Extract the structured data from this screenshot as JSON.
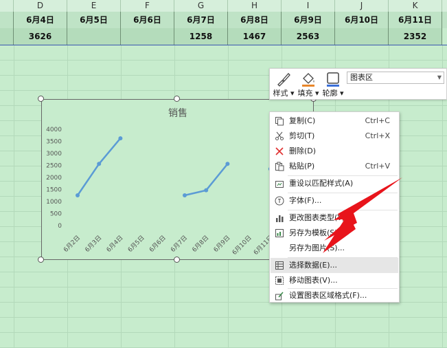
{
  "columns": [
    {
      "letter": "D",
      "header": "6月4日",
      "value": "3626"
    },
    {
      "letter": "E",
      "header": "6月5日",
      "value": ""
    },
    {
      "letter": "F",
      "header": "6月6日",
      "value": ""
    },
    {
      "letter": "G",
      "header": "6月7日",
      "value": "1258"
    },
    {
      "letter": "H",
      "header": "6月8日",
      "value": "1467"
    },
    {
      "letter": "I",
      "header": "6月9日",
      "value": "2563"
    },
    {
      "letter": "J",
      "header": "6月10日",
      "value": ""
    },
    {
      "letter": "K",
      "header": "6月11日",
      "value": "2352"
    }
  ],
  "toolbar": {
    "style_label": "样式",
    "fill_label": "填充",
    "outline_label": "轮廓",
    "element_select_value": "图表区"
  },
  "context_menu": {
    "items": [
      {
        "label": "复制(C)",
        "shortcut": "Ctrl+C",
        "icon": "copy-icon"
      },
      {
        "label": "剪切(T)",
        "shortcut": "Ctrl+X",
        "icon": "scissors-icon"
      },
      {
        "label": "删除(D)",
        "shortcut": "",
        "icon": "delete-x-icon"
      },
      {
        "label": "粘贴(P)",
        "shortcut": "Ctrl+V",
        "icon": "paste-icon"
      },
      {
        "label": "重设以匹配样式(A)",
        "shortcut": "",
        "icon": "reset-style-icon"
      },
      {
        "label": "字体(F)...",
        "shortcut": "",
        "icon": "font-icon"
      },
      {
        "label": "更改图表类型(Y)...",
        "shortcut": "",
        "icon": "chart-type-icon"
      },
      {
        "label": "另存为模板(S)...",
        "shortcut": "",
        "icon": "save-template-icon"
      },
      {
        "label": "另存为图片(S)...",
        "shortcut": "",
        "icon": ""
      },
      {
        "label": "选择数据(E)...",
        "shortcut": "",
        "icon": "select-data-icon"
      },
      {
        "label": "移动图表(V)...",
        "shortcut": "",
        "icon": "move-chart-icon"
      },
      {
        "label": "设置图表区域格式(F)...",
        "shortcut": "",
        "icon": "format-area-icon"
      }
    ],
    "hovered_index": 9
  },
  "chart_data": {
    "type": "line",
    "title": "销售",
    "categories": [
      "6月2日",
      "6月3日",
      "6月4日",
      "6月5日",
      "6月6日",
      "6月7日",
      "6月8日",
      "6月9日",
      "6月10日",
      "6月11日"
    ],
    "series": [
      {
        "values": [
          1258,
          2563,
          3626,
          null,
          null,
          1258,
          1467,
          2563,
          null,
          2352
        ],
        "color": "#5b9bd5"
      }
    ],
    "ylim": [
      0,
      4000
    ],
    "yticks": [
      "4000",
      "3500",
      "3000",
      "2500",
      "2000",
      "1500",
      "1000",
      "500",
      "0"
    ],
    "grid": false,
    "legend": "none"
  },
  "colors": {
    "sheet_bg": "#c7eccd",
    "line": "#5b9bd5",
    "arrow": "#e8141b",
    "delete_icon": "#e03030"
  }
}
